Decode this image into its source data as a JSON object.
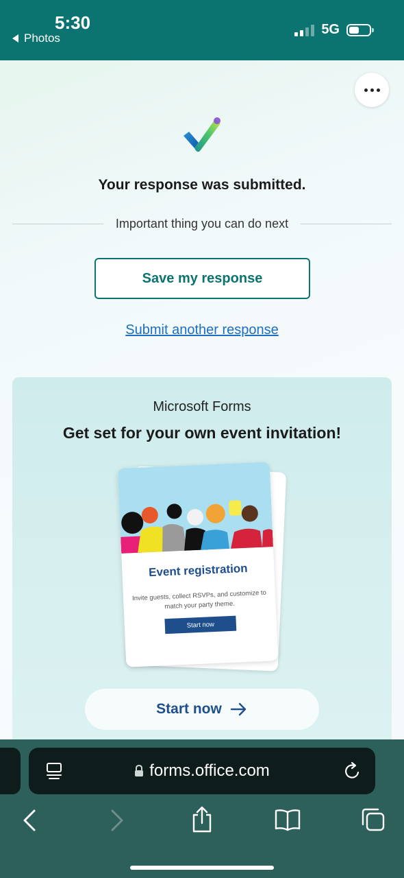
{
  "status": {
    "time": "5:30",
    "back_label": "Photos",
    "network": "5G"
  },
  "form": {
    "confirmation": "Your response was submitted.",
    "next_label": "Important thing you can do next",
    "save_label": "Save my response",
    "another_label": "Submit another response"
  },
  "promo": {
    "brand": "Microsoft Forms",
    "title": "Get set for your own event invitation!",
    "card_heading": "Event registration",
    "card_desc": "Invite guests, collect RSVPs, and customize to match your party theme.",
    "card_button": "Start now",
    "cta_label": "Start now"
  },
  "browser": {
    "url": "forms.office.com"
  },
  "colors": {
    "accent": "#0c7470",
    "link": "#1b6ec2",
    "brand_blue": "#1e4e8c"
  },
  "icons": [
    "more-icon",
    "checkmark-icon",
    "lock-icon",
    "reader-icon",
    "reload-icon",
    "back-icon",
    "forward-icon",
    "share-icon",
    "bookmarks-icon",
    "tabs-icon",
    "arrow-right-icon"
  ]
}
